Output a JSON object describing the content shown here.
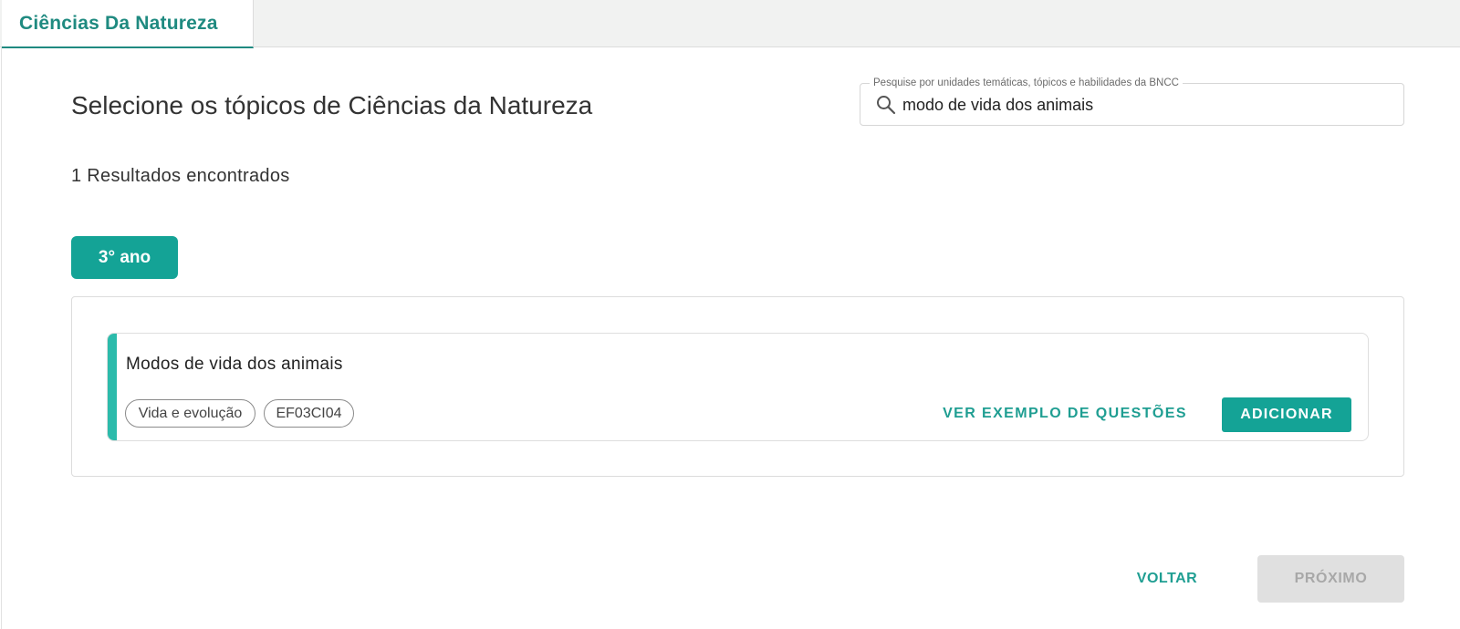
{
  "tabs": [
    {
      "label": "Ciências Da Natureza",
      "active": true
    }
  ],
  "page": {
    "title": "Selecione os tópicos de Ciências da Natureza",
    "results_text": "1 Resultados encontrados"
  },
  "search": {
    "label": "Pesquise por unidades temáticas, tópicos e habilidades da BNCC",
    "value": "modo de vida dos animais",
    "icon": "search-icon"
  },
  "group": {
    "year_label": "3° ano",
    "topics": [
      {
        "title": "Modos de vida dos animais",
        "tags": [
          "Vida e evolução",
          "EF03CI04"
        ],
        "examples_button": "VER EXEMPLO DE QUESTÕES",
        "add_button": "ADICIONAR"
      }
    ]
  },
  "footer": {
    "back_label": "VOLTAR",
    "next_label": "PRÓXIMO",
    "next_enabled": false
  },
  "colors": {
    "accent": "#1f8a80",
    "primary_button": "#14a396",
    "card_accent": "#2cbbab",
    "disabled_button": "#e0e0e0"
  }
}
